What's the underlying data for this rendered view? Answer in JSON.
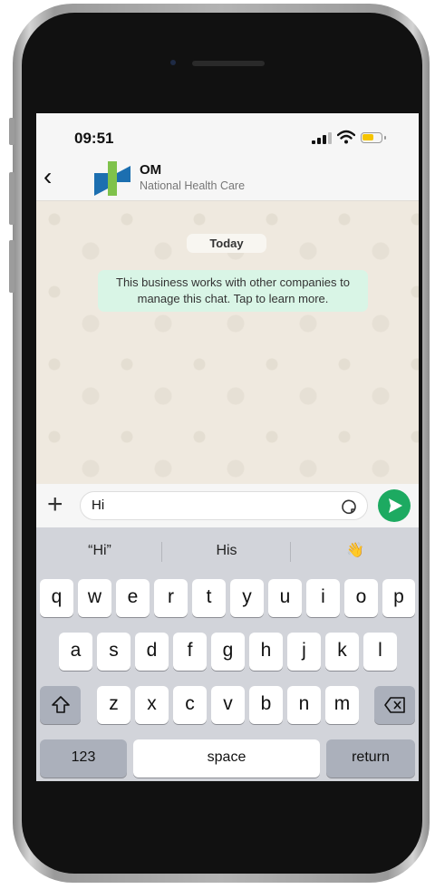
{
  "status": {
    "time": "09:51"
  },
  "header": {
    "title": "OM",
    "subtitle": "National Health Care",
    "back_icon": "chevron-left-icon"
  },
  "chat": {
    "date_label": "Today",
    "notice": "This business works with other companies to manage this chat. Tap to learn more."
  },
  "composer": {
    "value": "Hi",
    "plus_icon": "plus-icon",
    "sticker_icon": "sticker-icon",
    "send_icon": "send-icon",
    "send_color": "#1daa61"
  },
  "keyboard": {
    "suggestions": [
      "“Hi”",
      "His",
      "👋"
    ],
    "row1": [
      "q",
      "w",
      "e",
      "r",
      "t",
      "y",
      "u",
      "i",
      "o",
      "p"
    ],
    "row2": [
      "a",
      "s",
      "d",
      "f",
      "g",
      "h",
      "j",
      "k",
      "l"
    ],
    "row3": [
      "z",
      "x",
      "c",
      "v",
      "b",
      "n",
      "m"
    ],
    "shift_icon": "shift-icon",
    "delete_icon": "backspace-icon",
    "numbers": "123",
    "space": "space",
    "return": "return"
  }
}
